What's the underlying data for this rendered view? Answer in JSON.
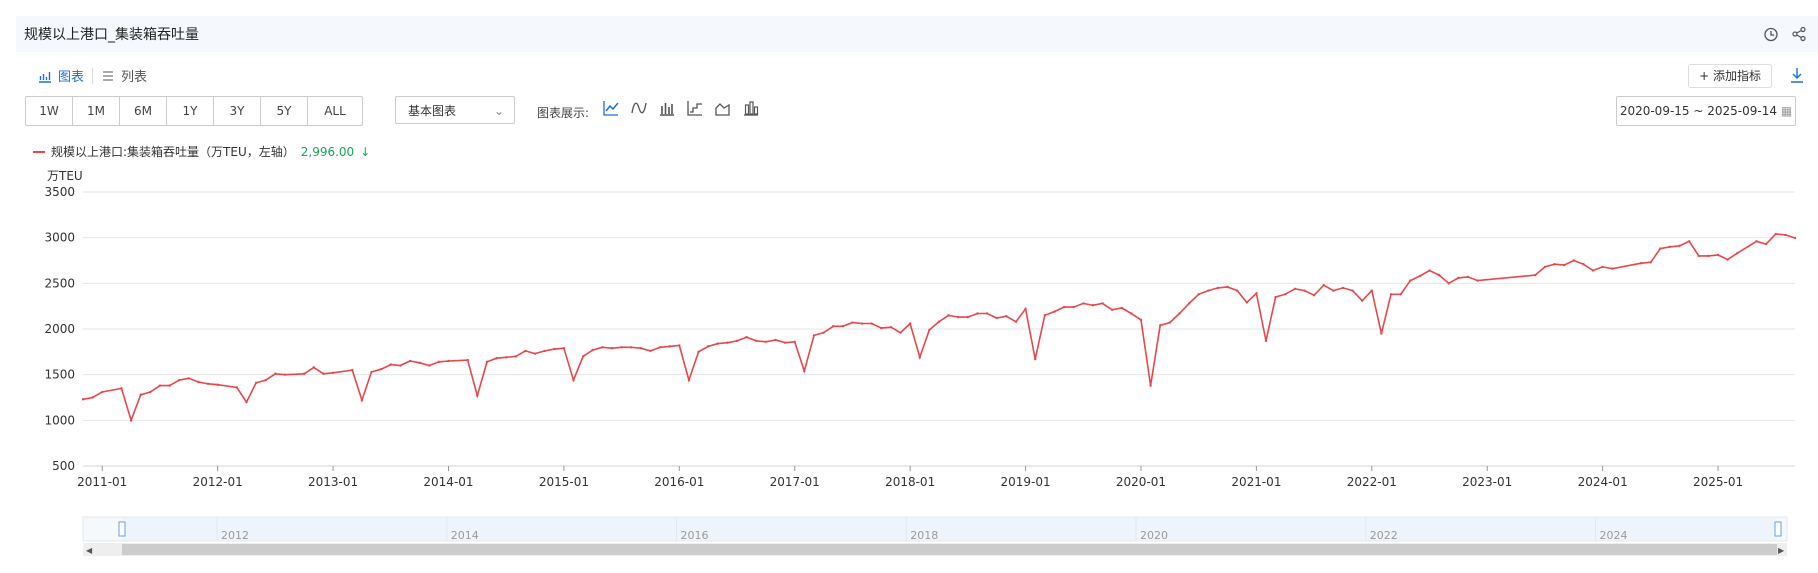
{
  "header": {
    "title": "规模以上港口_集装箱吞吐量",
    "icons": [
      "clock-icon",
      "share-icon"
    ]
  },
  "tabs": [
    {
      "label": "图表",
      "icon": "chart-icon"
    },
    {
      "label": "列表",
      "icon": "list-icon"
    }
  ],
  "toolbar": {
    "add_label": "+ 添加指标",
    "ranges": [
      "1W",
      "1M",
      "6M",
      "1Y",
      "3Y",
      "5Y",
      "ALL"
    ],
    "chart_type": "基本图表",
    "display_label": "图表展示:",
    "date_from": "2020-09-15",
    "date_to": "2025-09-14",
    "accent_color": "#1e6fd9"
  },
  "legend": {
    "label": "规模以上港口:集装箱吞吐量（万TEU，左轴）",
    "value": "2,996.00",
    "series_color": "#e8474c",
    "value_color": "#1aa35a"
  },
  "navigator": {
    "years": [
      "2012",
      "2014",
      "2016",
      "2018",
      "2020",
      "2022",
      "2024"
    ]
  },
  "chart_data": {
    "type": "line",
    "ylabel": "万TEU",
    "ylim": [
      500,
      3500
    ],
    "yticks": [
      500,
      1000,
      1500,
      2000,
      2500,
      3000,
      3500
    ],
    "xlim": [
      "2010-11",
      "2025-09"
    ],
    "xticks": [
      "2011-01",
      "2012-01",
      "2013-01",
      "2014-01",
      "2015-01",
      "2016-01",
      "2017-01",
      "2018-01",
      "2019-01",
      "2020-01",
      "2021-01",
      "2022-01",
      "2023-01",
      "2024-01",
      "2025-01"
    ],
    "grid": true,
    "series": [
      {
        "name": "规模以上港口:集装箱吞吐量",
        "color": "#e8474c",
        "points": [
          [
            "2010-11",
            1230
          ],
          [
            "2010-12",
            1250
          ],
          [
            "2011-01",
            1310
          ],
          [
            "2011-03",
            1350
          ],
          [
            "2011-04",
            1000
          ],
          [
            "2011-05",
            1280
          ],
          [
            "2011-06",
            1310
          ],
          [
            "2011-07",
            1380
          ],
          [
            "2011-08",
            1380
          ],
          [
            "2011-09",
            1440
          ],
          [
            "2011-10",
            1460
          ],
          [
            "2011-11",
            1420
          ],
          [
            "2011-12",
            1400
          ],
          [
            "2012-01",
            1390
          ],
          [
            "2012-03",
            1360
          ],
          [
            "2012-04",
            1200
          ],
          [
            "2012-05",
            1410
          ],
          [
            "2012-06",
            1440
          ],
          [
            "2012-07",
            1510
          ],
          [
            "2012-08",
            1500
          ],
          [
            "2012-10",
            1510
          ],
          [
            "2012-11",
            1580
          ],
          [
            "2012-12",
            1510
          ],
          [
            "2013-01",
            1520
          ],
          [
            "2013-03",
            1550
          ],
          [
            "2013-04",
            1220
          ],
          [
            "2013-05",
            1530
          ],
          [
            "2013-06",
            1560
          ],
          [
            "2013-07",
            1610
          ],
          [
            "2013-08",
            1600
          ],
          [
            "2013-09",
            1650
          ],
          [
            "2013-10",
            1630
          ],
          [
            "2013-11",
            1600
          ],
          [
            "2013-12",
            1640
          ],
          [
            "2014-01",
            1650
          ],
          [
            "2014-03",
            1660
          ],
          [
            "2014-04",
            1270
          ],
          [
            "2014-05",
            1640
          ],
          [
            "2014-06",
            1680
          ],
          [
            "2014-07",
            1690
          ],
          [
            "2014-08",
            1700
          ],
          [
            "2014-09",
            1760
          ],
          [
            "2014-10",
            1730
          ],
          [
            "2014-11",
            1760
          ],
          [
            "2014-12",
            1780
          ],
          [
            "2015-01",
            1790
          ],
          [
            "2015-02",
            1440
          ],
          [
            "2015-03",
            1700
          ],
          [
            "2015-04",
            1770
          ],
          [
            "2015-05",
            1800
          ],
          [
            "2015-06",
            1790
          ],
          [
            "2015-07",
            1800
          ],
          [
            "2015-08",
            1800
          ],
          [
            "2015-09",
            1790
          ],
          [
            "2015-10",
            1760
          ],
          [
            "2015-11",
            1800
          ],
          [
            "2015-12",
            1810
          ],
          [
            "2016-01",
            1820
          ],
          [
            "2016-02",
            1440
          ],
          [
            "2016-03",
            1750
          ],
          [
            "2016-04",
            1810
          ],
          [
            "2016-05",
            1840
          ],
          [
            "2016-06",
            1850
          ],
          [
            "2016-07",
            1870
          ],
          [
            "2016-08",
            1910
          ],
          [
            "2016-09",
            1870
          ],
          [
            "2016-10",
            1860
          ],
          [
            "2016-11",
            1880
          ],
          [
            "2016-12",
            1850
          ],
          [
            "2017-01",
            1860
          ],
          [
            "2017-02",
            1540
          ],
          [
            "2017-03",
            1930
          ],
          [
            "2017-04",
            1960
          ],
          [
            "2017-05",
            2030
          ],
          [
            "2017-06",
            2030
          ],
          [
            "2017-07",
            2070
          ],
          [
            "2017-08",
            2060
          ],
          [
            "2017-09",
            2060
          ],
          [
            "2017-10",
            2010
          ],
          [
            "2017-11",
            2020
          ],
          [
            "2017-12",
            1960
          ],
          [
            "2018-01",
            2060
          ],
          [
            "2018-02",
            1690
          ],
          [
            "2018-03",
            1990
          ],
          [
            "2018-04",
            2080
          ],
          [
            "2018-05",
            2150
          ],
          [
            "2018-06",
            2130
          ],
          [
            "2018-07",
            2130
          ],
          [
            "2018-08",
            2170
          ],
          [
            "2018-09",
            2170
          ],
          [
            "2018-10",
            2120
          ],
          [
            "2018-11",
            2140
          ],
          [
            "2018-12",
            2080
          ],
          [
            "2019-01",
            2220
          ],
          [
            "2019-02",
            1670
          ],
          [
            "2019-03",
            2150
          ],
          [
            "2019-04",
            2190
          ],
          [
            "2019-05",
            2240
          ],
          [
            "2019-06",
            2240
          ],
          [
            "2019-07",
            2280
          ],
          [
            "2019-08",
            2260
          ],
          [
            "2019-09",
            2280
          ],
          [
            "2019-10",
            2210
          ],
          [
            "2019-11",
            2230
          ],
          [
            "2019-12",
            2170
          ],
          [
            "2020-01",
            2100
          ],
          [
            "2020-02",
            1380
          ],
          [
            "2020-03",
            2040
          ],
          [
            "2020-04",
            2070
          ],
          [
            "2020-05",
            2170
          ],
          [
            "2020-06",
            2280
          ],
          [
            "2020-07",
            2380
          ],
          [
            "2020-08",
            2420
          ],
          [
            "2020-09",
            2450
          ],
          [
            "2020-10",
            2460
          ],
          [
            "2020-11",
            2420
          ],
          [
            "2020-12",
            2290
          ],
          [
            "2021-01",
            2390
          ],
          [
            "2021-02",
            1870
          ],
          [
            "2021-03",
            2350
          ],
          [
            "2021-04",
            2380
          ],
          [
            "2021-05",
            2440
          ],
          [
            "2021-06",
            2420
          ],
          [
            "2021-07",
            2370
          ],
          [
            "2021-08",
            2480
          ],
          [
            "2021-09",
            2420
          ],
          [
            "2021-10",
            2450
          ],
          [
            "2021-11",
            2420
          ],
          [
            "2021-12",
            2310
          ],
          [
            "2022-01",
            2420
          ],
          [
            "2022-02",
            1950
          ],
          [
            "2022-03",
            2380
          ],
          [
            "2022-04",
            2380
          ],
          [
            "2022-05",
            2530
          ],
          [
            "2022-06",
            2580
          ],
          [
            "2022-07",
            2640
          ],
          [
            "2022-08",
            2590
          ],
          [
            "2022-09",
            2500
          ],
          [
            "2022-10",
            2560
          ],
          [
            "2022-11",
            2570
          ],
          [
            "2022-12",
            2530
          ],
          [
            "2023-06",
            2590
          ],
          [
            "2023-07",
            2680
          ],
          [
            "2023-08",
            2710
          ],
          [
            "2023-09",
            2700
          ],
          [
            "2023-10",
            2750
          ],
          [
            "2023-11",
            2710
          ],
          [
            "2023-12",
            2640
          ],
          [
            "2024-01",
            2680
          ],
          [
            "2024-02",
            2660
          ],
          [
            "2024-05",
            2720
          ],
          [
            "2024-06",
            2730
          ],
          [
            "2024-07",
            2880
          ],
          [
            "2024-08",
            2900
          ],
          [
            "2024-09",
            2910
          ],
          [
            "2024-10",
            2960
          ],
          [
            "2024-11",
            2800
          ],
          [
            "2024-12",
            2800
          ],
          [
            "2025-01",
            2810
          ],
          [
            "2025-02",
            2760
          ],
          [
            "2025-03",
            2830
          ],
          [
            "2025-05",
            2960
          ],
          [
            "2025-06",
            2930
          ],
          [
            "2025-07",
            3040
          ],
          [
            "2025-08",
            3030
          ],
          [
            "2025-09",
            2996
          ]
        ]
      }
    ]
  }
}
